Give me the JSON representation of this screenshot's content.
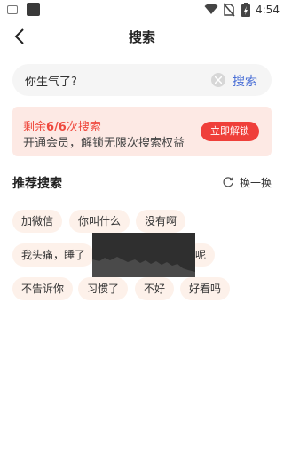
{
  "status_bar": {
    "time": "4:54"
  },
  "nav": {
    "title": "搜索"
  },
  "search": {
    "value": "你生气了?",
    "button": "搜索"
  },
  "promo": {
    "prefix": "剩余",
    "count": "6/6",
    "suffix": "次搜索",
    "subtitle": "开通会员，解锁无限次搜索权益",
    "button": "立即解锁"
  },
  "recommend": {
    "title": "推荐搜索",
    "refresh": "换一换",
    "tags": [
      "加微信",
      "你叫什么",
      "没有啊",
      "我头痛，睡了",
      "呢",
      "不告诉你",
      "习惯了",
      "不好",
      "好看吗"
    ]
  },
  "colors": {
    "accent": "#4a6fd6",
    "brand_red": "#ef3f3a",
    "promo_bg": "#fde9e4",
    "tag_bg": "#fdf1ea"
  }
}
